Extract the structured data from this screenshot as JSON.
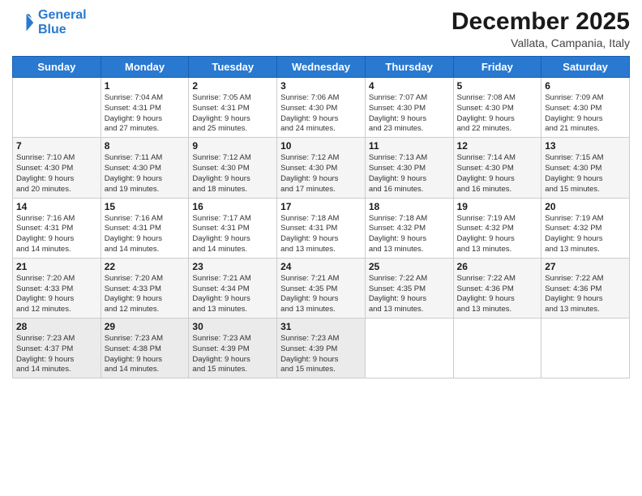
{
  "logo": {
    "line1": "General",
    "line2": "Blue"
  },
  "title": "December 2025",
  "location": "Vallata, Campania, Italy",
  "days_header": [
    "Sunday",
    "Monday",
    "Tuesday",
    "Wednesday",
    "Thursday",
    "Friday",
    "Saturday"
  ],
  "weeks": [
    [
      {
        "day": "",
        "info": ""
      },
      {
        "day": "1",
        "info": "Sunrise: 7:04 AM\nSunset: 4:31 PM\nDaylight: 9 hours\nand 27 minutes."
      },
      {
        "day": "2",
        "info": "Sunrise: 7:05 AM\nSunset: 4:31 PM\nDaylight: 9 hours\nand 25 minutes."
      },
      {
        "day": "3",
        "info": "Sunrise: 7:06 AM\nSunset: 4:30 PM\nDaylight: 9 hours\nand 24 minutes."
      },
      {
        "day": "4",
        "info": "Sunrise: 7:07 AM\nSunset: 4:30 PM\nDaylight: 9 hours\nand 23 minutes."
      },
      {
        "day": "5",
        "info": "Sunrise: 7:08 AM\nSunset: 4:30 PM\nDaylight: 9 hours\nand 22 minutes."
      },
      {
        "day": "6",
        "info": "Sunrise: 7:09 AM\nSunset: 4:30 PM\nDaylight: 9 hours\nand 21 minutes."
      }
    ],
    [
      {
        "day": "7",
        "info": "Sunrise: 7:10 AM\nSunset: 4:30 PM\nDaylight: 9 hours\nand 20 minutes."
      },
      {
        "day": "8",
        "info": "Sunrise: 7:11 AM\nSunset: 4:30 PM\nDaylight: 9 hours\nand 19 minutes."
      },
      {
        "day": "9",
        "info": "Sunrise: 7:12 AM\nSunset: 4:30 PM\nDaylight: 9 hours\nand 18 minutes."
      },
      {
        "day": "10",
        "info": "Sunrise: 7:12 AM\nSunset: 4:30 PM\nDaylight: 9 hours\nand 17 minutes."
      },
      {
        "day": "11",
        "info": "Sunrise: 7:13 AM\nSunset: 4:30 PM\nDaylight: 9 hours\nand 16 minutes."
      },
      {
        "day": "12",
        "info": "Sunrise: 7:14 AM\nSunset: 4:30 PM\nDaylight: 9 hours\nand 16 minutes."
      },
      {
        "day": "13",
        "info": "Sunrise: 7:15 AM\nSunset: 4:30 PM\nDaylight: 9 hours\nand 15 minutes."
      }
    ],
    [
      {
        "day": "14",
        "info": "Sunrise: 7:16 AM\nSunset: 4:31 PM\nDaylight: 9 hours\nand 14 minutes."
      },
      {
        "day": "15",
        "info": "Sunrise: 7:16 AM\nSunset: 4:31 PM\nDaylight: 9 hours\nand 14 minutes."
      },
      {
        "day": "16",
        "info": "Sunrise: 7:17 AM\nSunset: 4:31 PM\nDaylight: 9 hours\nand 14 minutes."
      },
      {
        "day": "17",
        "info": "Sunrise: 7:18 AM\nSunset: 4:31 PM\nDaylight: 9 hours\nand 13 minutes."
      },
      {
        "day": "18",
        "info": "Sunrise: 7:18 AM\nSunset: 4:32 PM\nDaylight: 9 hours\nand 13 minutes."
      },
      {
        "day": "19",
        "info": "Sunrise: 7:19 AM\nSunset: 4:32 PM\nDaylight: 9 hours\nand 13 minutes."
      },
      {
        "day": "20",
        "info": "Sunrise: 7:19 AM\nSunset: 4:32 PM\nDaylight: 9 hours\nand 13 minutes."
      }
    ],
    [
      {
        "day": "21",
        "info": "Sunrise: 7:20 AM\nSunset: 4:33 PM\nDaylight: 9 hours\nand 12 minutes."
      },
      {
        "day": "22",
        "info": "Sunrise: 7:20 AM\nSunset: 4:33 PM\nDaylight: 9 hours\nand 12 minutes."
      },
      {
        "day": "23",
        "info": "Sunrise: 7:21 AM\nSunset: 4:34 PM\nDaylight: 9 hours\nand 13 minutes."
      },
      {
        "day": "24",
        "info": "Sunrise: 7:21 AM\nSunset: 4:35 PM\nDaylight: 9 hours\nand 13 minutes."
      },
      {
        "day": "25",
        "info": "Sunrise: 7:22 AM\nSunset: 4:35 PM\nDaylight: 9 hours\nand 13 minutes."
      },
      {
        "day": "26",
        "info": "Sunrise: 7:22 AM\nSunset: 4:36 PM\nDaylight: 9 hours\nand 13 minutes."
      },
      {
        "day": "27",
        "info": "Sunrise: 7:22 AM\nSunset: 4:36 PM\nDaylight: 9 hours\nand 13 minutes."
      }
    ],
    [
      {
        "day": "28",
        "info": "Sunrise: 7:23 AM\nSunset: 4:37 PM\nDaylight: 9 hours\nand 14 minutes."
      },
      {
        "day": "29",
        "info": "Sunrise: 7:23 AM\nSunset: 4:38 PM\nDaylight: 9 hours\nand 14 minutes."
      },
      {
        "day": "30",
        "info": "Sunrise: 7:23 AM\nSunset: 4:39 PM\nDaylight: 9 hours\nand 15 minutes."
      },
      {
        "day": "31",
        "info": "Sunrise: 7:23 AM\nSunset: 4:39 PM\nDaylight: 9 hours\nand 15 minutes."
      },
      {
        "day": "",
        "info": ""
      },
      {
        "day": "",
        "info": ""
      },
      {
        "day": "",
        "info": ""
      }
    ]
  ]
}
